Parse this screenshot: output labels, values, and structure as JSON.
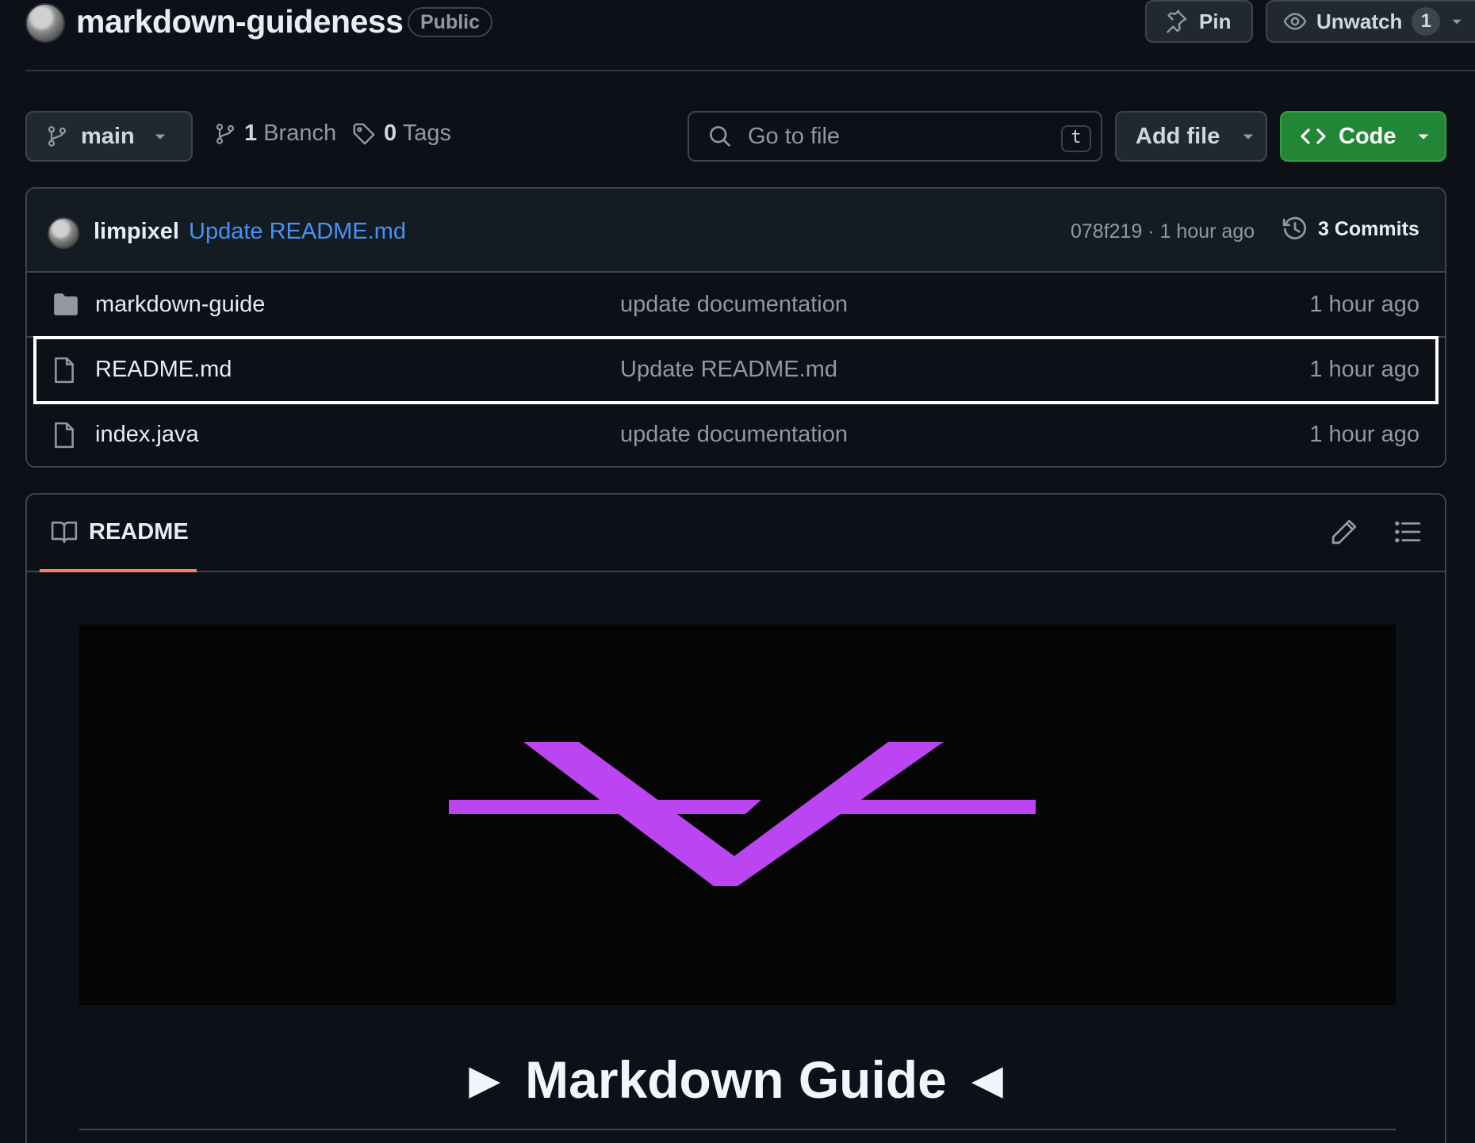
{
  "repo": {
    "name": "markdown-guideness",
    "visibility": "Public",
    "pin_label": "Pin",
    "watch_label": "Unwatch",
    "watch_count": "1"
  },
  "toolbar": {
    "branch": "main",
    "branches_count": "1",
    "branches_label": "Branch",
    "tags_count": "0",
    "tags_label": "Tags",
    "search_placeholder": "Go to file",
    "search_shortcut": "t",
    "add_file_label": "Add file",
    "code_label": "Code"
  },
  "commit": {
    "author": "limpixel",
    "message": "Update README.md",
    "sha_time": "078f219 · 1 hour ago",
    "commits_label": "3 Commits"
  },
  "files": [
    {
      "name": "markdown-guide",
      "type": "folder",
      "commit": "update documentation",
      "time": "1 hour ago"
    },
    {
      "name": "README.md",
      "type": "file",
      "commit": "Update README.md",
      "time": "1 hour ago"
    },
    {
      "name": "index.java",
      "type": "file",
      "commit": "update documentation",
      "time": "1 hour ago"
    }
  ],
  "readme": {
    "tab_label": "README",
    "heading": "► Markdown Guide ◄"
  },
  "colors": {
    "accent_green": "#238636",
    "link_blue": "#4493f8",
    "tab_underline": "#f78166",
    "logo_purple": "#bc45f2"
  },
  "icons": [
    "repo-avatar",
    "pin-icon",
    "eye-icon",
    "caret-down-icon",
    "git-branch-icon",
    "tag-icon",
    "search-icon",
    "code-icon",
    "history-icon",
    "folder-icon",
    "file-icon",
    "book-icon",
    "pencil-icon",
    "list-icon"
  ]
}
